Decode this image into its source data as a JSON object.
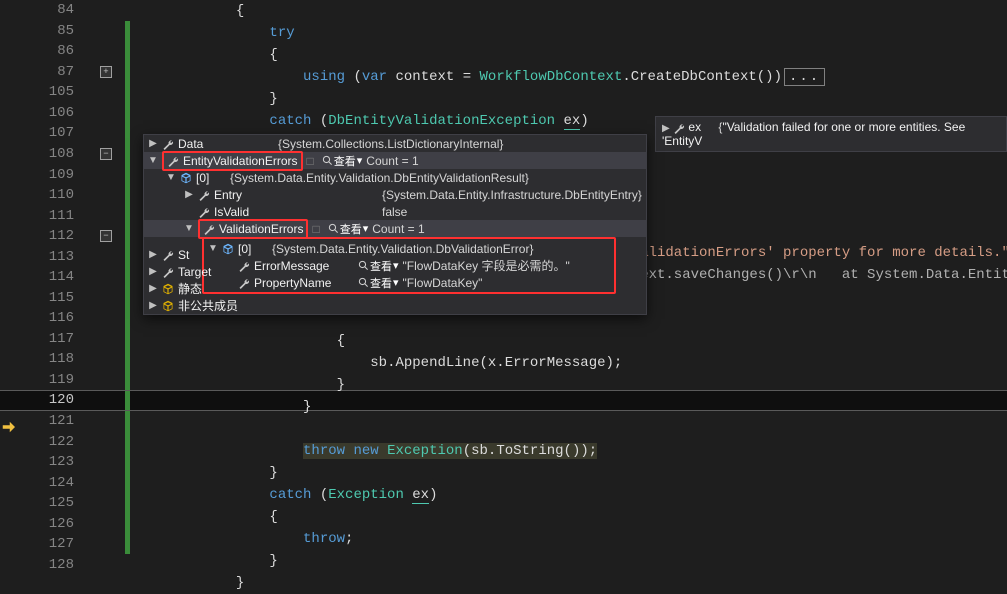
{
  "lines": [
    "84",
    "85",
    "86",
    "87",
    "105",
    "106",
    "107",
    "108",
    "109",
    "110",
    "111",
    "112",
    "113",
    "114",
    "115",
    "116",
    "117",
    "118",
    "119",
    "120",
    "121",
    "122",
    "123",
    "124",
    "125",
    "126",
    "127",
    "128"
  ],
  "code": {
    "try": "try",
    "using": "using",
    "var": "var",
    "context": "context",
    "wfdb": "WorkflowDbContext",
    "create": "CreateDbContext",
    "catch": "catch",
    "dbex": "DbEntityValidationException",
    "ex": "ex",
    "exType": "Exception",
    "sb": "sb",
    "append": "AppendLine",
    "xerr": "x.ErrorMessage",
    "throw": "throw",
    "new": "new",
    "tostr": "ToString",
    "validerrprop": "tyValidationErrors' property for more details.\"",
    "stacktrace": "ontext.saveChanges()\\r\\n   at System.Data.Entity.Internal.LazyInternalContext.S",
    "ellipsis": "..."
  },
  "popup": {
    "data": "Data",
    "dataVal": "{System.Collections.ListDictionaryInternal}",
    "eve": "EntityValidationErrors",
    "view": "查看",
    "count1": "Count = 1",
    "idx0": "[0]",
    "idx0val": "{System.Data.Entity.Validation.DbEntityValidationResult}",
    "entry": "Entry",
    "entryVal": "{System.Data.Entity.Infrastructure.DbEntityEntry}",
    "isvalid": "IsValid",
    "false": "false",
    "ve": "ValidationErrors",
    "ve0val": "{System.Data.Entity.Validation.DbValidationError}",
    "errmsg": "ErrorMessage",
    "errmsgVal": "\"FlowDataKey 字段是必需的。\"",
    "propname": "PropertyName",
    "propnameVal": "\"FlowDataKey\"",
    "st": "St",
    "target": "Target",
    "static": "静态",
    "nonpublic": "非公共成员"
  },
  "ex_hint": "\"Validation failed for one or more entities. See 'EntityV",
  "ex_hint_name": "ex"
}
